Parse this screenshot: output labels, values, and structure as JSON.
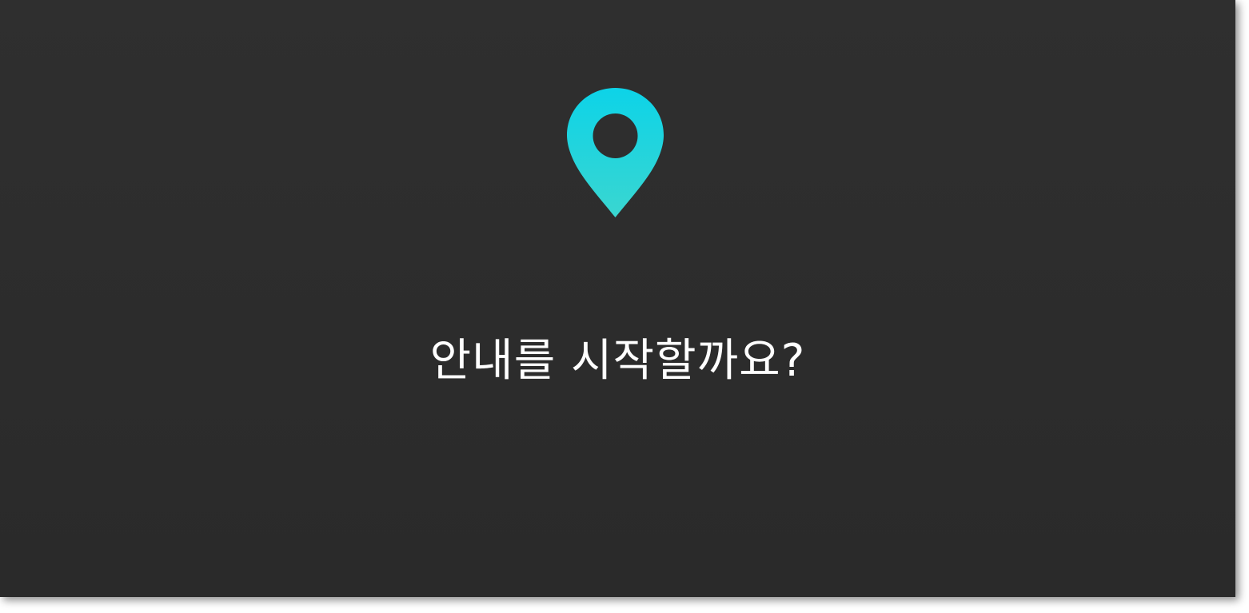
{
  "prompt": {
    "text": "안내를 시작할까요?"
  },
  "icon": {
    "name": "location-pin-icon",
    "gradient_top": "#0dd3e8",
    "gradient_bottom": "#3ad6d0"
  },
  "colors": {
    "background": "#2d2d2d",
    "text": "#ffffff"
  }
}
